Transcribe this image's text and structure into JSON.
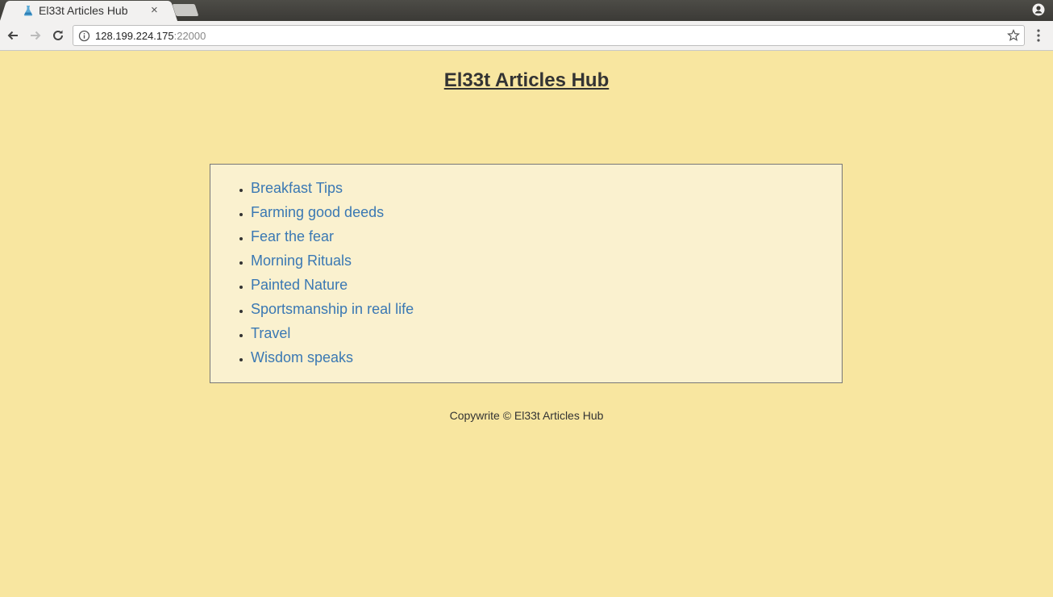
{
  "browser": {
    "tab_title": "El33t Articles Hub",
    "tab_close": "×",
    "url_host": "128.199.224.175",
    "url_port": ":22000"
  },
  "page": {
    "title": "El33t Articles Hub",
    "articles": [
      "Breakfast Tips",
      "Farming good deeds",
      "Fear the fear",
      "Morning Rituals",
      "Painted Nature",
      "Sportsmanship in real life",
      "Travel",
      "Wisdom speaks"
    ],
    "footer": "Copywrite © El33t Articles Hub"
  },
  "colors": {
    "page_background": "#f8e6a0",
    "box_background": "#faf1cf",
    "link": "#3a78b3"
  }
}
